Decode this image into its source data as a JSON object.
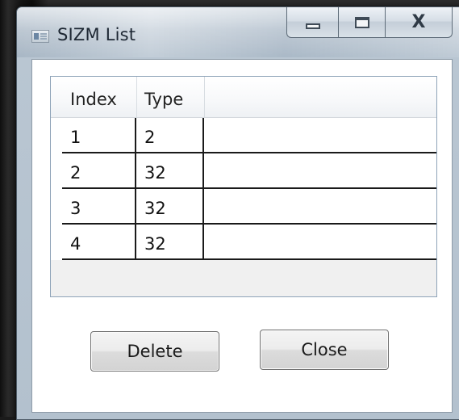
{
  "window": {
    "title": "SIZM List",
    "icon": "window-app-icon",
    "caption_buttons": [
      "minimize-icon",
      "maximize-icon",
      "close-icon"
    ],
    "close_glyph": "X"
  },
  "grid": {
    "columns": [
      "Index",
      "Type"
    ],
    "rows": [
      {
        "index": "1",
        "type": "2"
      },
      {
        "index": "2",
        "type": "32"
      },
      {
        "index": "3",
        "type": "32"
      },
      {
        "index": "4",
        "type": "32"
      }
    ]
  },
  "buttons": {
    "delete_label": "Delete",
    "close_label": "Close"
  }
}
